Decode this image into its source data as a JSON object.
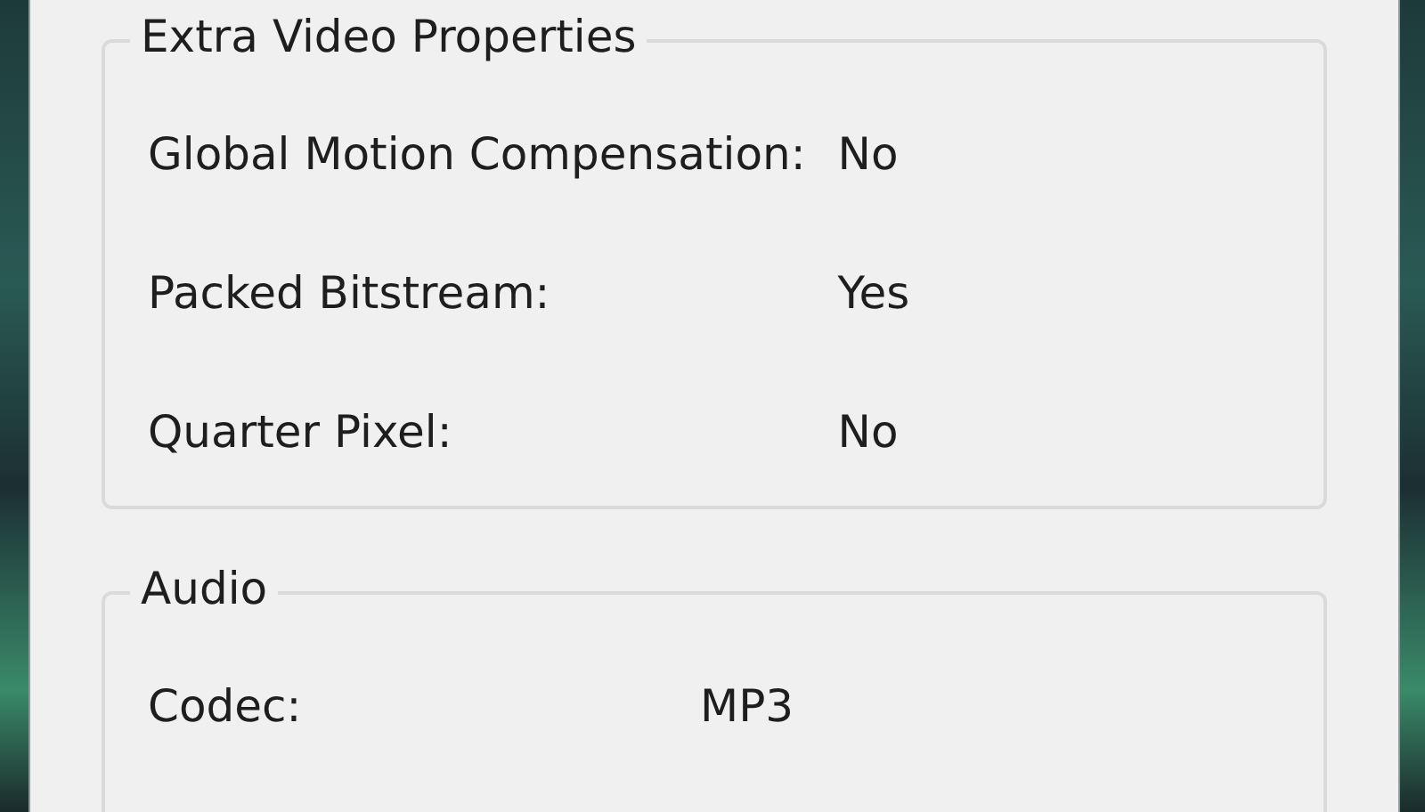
{
  "groups": [
    {
      "title": "Extra Video Properties",
      "rows": [
        {
          "label": "Global Motion Compensation:",
          "value": "No"
        },
        {
          "label": "Packed Bitstream:",
          "value": "Yes"
        },
        {
          "label": "Quarter Pixel:",
          "value": "No"
        }
      ]
    },
    {
      "title": "Audio",
      "rows": [
        {
          "label": "Codec:",
          "value": "MP3"
        }
      ]
    }
  ]
}
